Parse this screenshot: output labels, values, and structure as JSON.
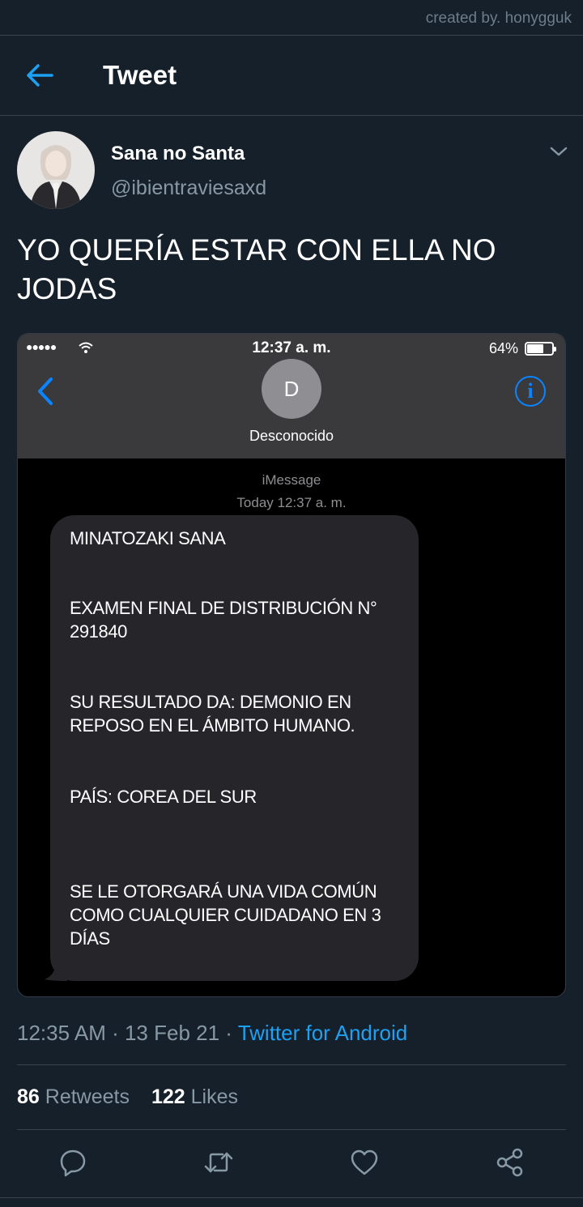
{
  "credit": "created by. honygguk",
  "header": {
    "title": "Tweet"
  },
  "tweet": {
    "display_name": "Sana no Santa",
    "handle": "@ibientraviesaxd",
    "text_lines": [
      "YO QUERÍA ESTAR CON ELLA NO",
      "JODAS"
    ],
    "timestamp": "12:35 AM · 13 Feb 21 · ",
    "source": "Twitter for Android",
    "retweets": {
      "count": "86",
      "label": "Retweets"
    },
    "likes": {
      "count": "122",
      "label": "Likes"
    }
  },
  "screenshot": {
    "status": {
      "time": "12:37 a. m.",
      "battery": "64%"
    },
    "contact": {
      "initial": "D",
      "name": "Desconocido"
    },
    "info_glyph": "i",
    "service": "iMessage",
    "date": "Today 12:37 a. m.",
    "message_lines": [
      "MINATOZAKI SANA",
      "EXAMEN FINAL DE DISTRIBUCIÓN N°",
      "291840",
      "SU RESULTADO DA: DEMONIO EN",
      "REPOSO EN EL ÁMBITO HUMANO.",
      "PAÍS: COREA DEL SUR",
      "SE LE OTORGARÁ UNA VIDA COMÚN",
      "COMO CUALQUIER CUIDADANO  EN 3",
      "DÍAS"
    ]
  },
  "colors": {
    "background": "#15202b",
    "accent": "#1da1f2",
    "secondary_text": "#8899a6",
    "ios_blue": "#0a84ff",
    "bubble": "#262529"
  },
  "icons": {
    "back": "arrow-left-icon",
    "more": "chevron-down-icon",
    "reply": "comment-icon",
    "retweet": "retweet-icon",
    "like": "heart-icon",
    "share": "share-icon"
  }
}
